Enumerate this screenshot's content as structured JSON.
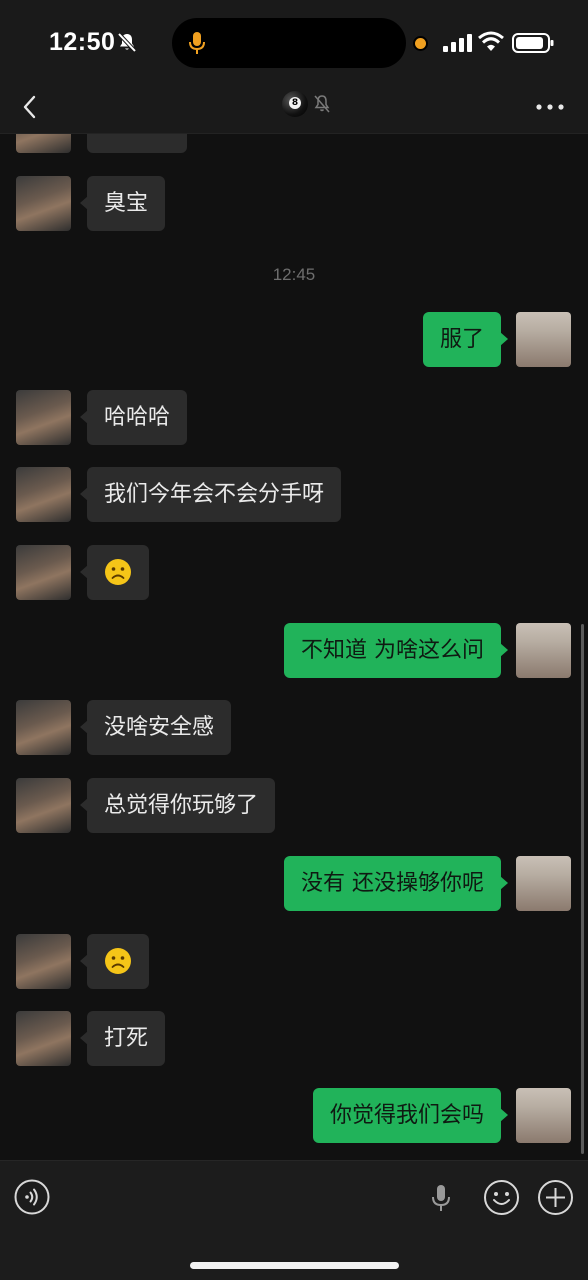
{
  "status_bar": {
    "time": "12:50",
    "icons": [
      "bell-off-icon",
      "microphone-indicator-icon",
      "orange-dot-indicator",
      "signal-icon",
      "wifi-icon",
      "battery-icon"
    ],
    "mic_indicator_color": "#f0a020"
  },
  "header": {
    "contact_avatar_label": "8",
    "icons": [
      "back-icon",
      "mute-icon",
      "more-icon"
    ]
  },
  "chat": {
    "timestamp": "12:45",
    "messages": [
      {
        "side": "in",
        "text": "臭宝"
      },
      {
        "side": "out",
        "text": "服了"
      },
      {
        "side": "in",
        "text": "哈哈哈"
      },
      {
        "side": "in",
        "text": "我们今年会不会分手呀"
      },
      {
        "side": "in",
        "text": "",
        "emoji": "sad-face-emoji"
      },
      {
        "side": "out",
        "text": "不知道 为啥这么问"
      },
      {
        "side": "in",
        "text": "没啥安全感"
      },
      {
        "side": "in",
        "text": "总觉得你玩够了"
      },
      {
        "side": "out",
        "text": "没有 还没操够你呢"
      },
      {
        "side": "in",
        "text": "",
        "emoji": "sad-face-emoji"
      },
      {
        "side": "in",
        "text": "打死"
      },
      {
        "side": "out",
        "text": "你觉得我们会吗"
      }
    ]
  },
  "input_bar": {
    "icons": [
      "voice-icon",
      "microphone-icon",
      "emoji-icon",
      "plus-icon"
    ]
  },
  "colors": {
    "background": "#111111",
    "incoming_bubble": "#2c2c2c",
    "outgoing_bubble": "#21b35a"
  }
}
